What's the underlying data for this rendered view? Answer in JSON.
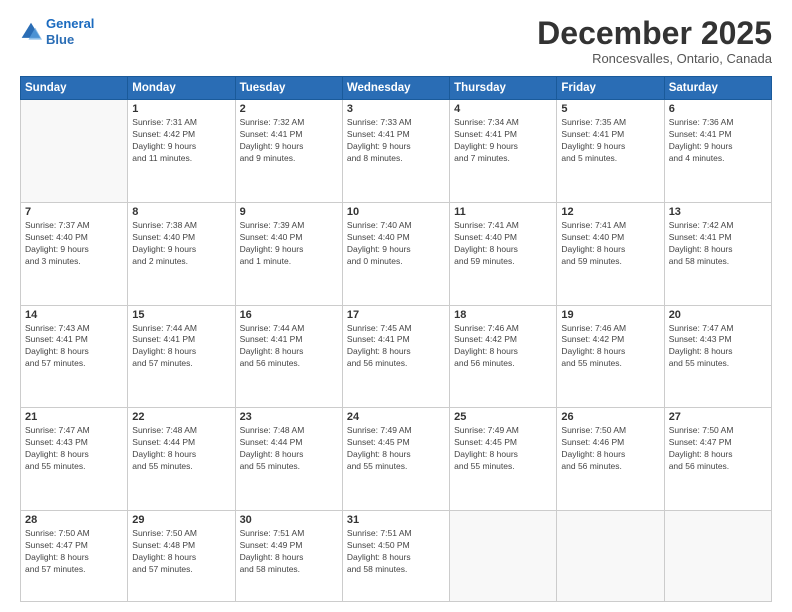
{
  "logo": {
    "line1": "General",
    "line2": "Blue"
  },
  "title": "December 2025",
  "location": "Roncesvalles, Ontario, Canada",
  "days_header": [
    "Sunday",
    "Monday",
    "Tuesday",
    "Wednesday",
    "Thursday",
    "Friday",
    "Saturday"
  ],
  "weeks": [
    [
      {
        "num": "",
        "info": ""
      },
      {
        "num": "1",
        "info": "Sunrise: 7:31 AM\nSunset: 4:42 PM\nDaylight: 9 hours\nand 11 minutes."
      },
      {
        "num": "2",
        "info": "Sunrise: 7:32 AM\nSunset: 4:41 PM\nDaylight: 9 hours\nand 9 minutes."
      },
      {
        "num": "3",
        "info": "Sunrise: 7:33 AM\nSunset: 4:41 PM\nDaylight: 9 hours\nand 8 minutes."
      },
      {
        "num": "4",
        "info": "Sunrise: 7:34 AM\nSunset: 4:41 PM\nDaylight: 9 hours\nand 7 minutes."
      },
      {
        "num": "5",
        "info": "Sunrise: 7:35 AM\nSunset: 4:41 PM\nDaylight: 9 hours\nand 5 minutes."
      },
      {
        "num": "6",
        "info": "Sunrise: 7:36 AM\nSunset: 4:41 PM\nDaylight: 9 hours\nand 4 minutes."
      }
    ],
    [
      {
        "num": "7",
        "info": "Sunrise: 7:37 AM\nSunset: 4:40 PM\nDaylight: 9 hours\nand 3 minutes."
      },
      {
        "num": "8",
        "info": "Sunrise: 7:38 AM\nSunset: 4:40 PM\nDaylight: 9 hours\nand 2 minutes."
      },
      {
        "num": "9",
        "info": "Sunrise: 7:39 AM\nSunset: 4:40 PM\nDaylight: 9 hours\nand 1 minute."
      },
      {
        "num": "10",
        "info": "Sunrise: 7:40 AM\nSunset: 4:40 PM\nDaylight: 9 hours\nand 0 minutes."
      },
      {
        "num": "11",
        "info": "Sunrise: 7:41 AM\nSunset: 4:40 PM\nDaylight: 8 hours\nand 59 minutes."
      },
      {
        "num": "12",
        "info": "Sunrise: 7:41 AM\nSunset: 4:40 PM\nDaylight: 8 hours\nand 59 minutes."
      },
      {
        "num": "13",
        "info": "Sunrise: 7:42 AM\nSunset: 4:41 PM\nDaylight: 8 hours\nand 58 minutes."
      }
    ],
    [
      {
        "num": "14",
        "info": "Sunrise: 7:43 AM\nSunset: 4:41 PM\nDaylight: 8 hours\nand 57 minutes."
      },
      {
        "num": "15",
        "info": "Sunrise: 7:44 AM\nSunset: 4:41 PM\nDaylight: 8 hours\nand 57 minutes."
      },
      {
        "num": "16",
        "info": "Sunrise: 7:44 AM\nSunset: 4:41 PM\nDaylight: 8 hours\nand 56 minutes."
      },
      {
        "num": "17",
        "info": "Sunrise: 7:45 AM\nSunset: 4:41 PM\nDaylight: 8 hours\nand 56 minutes."
      },
      {
        "num": "18",
        "info": "Sunrise: 7:46 AM\nSunset: 4:42 PM\nDaylight: 8 hours\nand 56 minutes."
      },
      {
        "num": "19",
        "info": "Sunrise: 7:46 AM\nSunset: 4:42 PM\nDaylight: 8 hours\nand 55 minutes."
      },
      {
        "num": "20",
        "info": "Sunrise: 7:47 AM\nSunset: 4:43 PM\nDaylight: 8 hours\nand 55 minutes."
      }
    ],
    [
      {
        "num": "21",
        "info": "Sunrise: 7:47 AM\nSunset: 4:43 PM\nDaylight: 8 hours\nand 55 minutes."
      },
      {
        "num": "22",
        "info": "Sunrise: 7:48 AM\nSunset: 4:44 PM\nDaylight: 8 hours\nand 55 minutes."
      },
      {
        "num": "23",
        "info": "Sunrise: 7:48 AM\nSunset: 4:44 PM\nDaylight: 8 hours\nand 55 minutes."
      },
      {
        "num": "24",
        "info": "Sunrise: 7:49 AM\nSunset: 4:45 PM\nDaylight: 8 hours\nand 55 minutes."
      },
      {
        "num": "25",
        "info": "Sunrise: 7:49 AM\nSunset: 4:45 PM\nDaylight: 8 hours\nand 55 minutes."
      },
      {
        "num": "26",
        "info": "Sunrise: 7:50 AM\nSunset: 4:46 PM\nDaylight: 8 hours\nand 56 minutes."
      },
      {
        "num": "27",
        "info": "Sunrise: 7:50 AM\nSunset: 4:47 PM\nDaylight: 8 hours\nand 56 minutes."
      }
    ],
    [
      {
        "num": "28",
        "info": "Sunrise: 7:50 AM\nSunset: 4:47 PM\nDaylight: 8 hours\nand 57 minutes."
      },
      {
        "num": "29",
        "info": "Sunrise: 7:50 AM\nSunset: 4:48 PM\nDaylight: 8 hours\nand 57 minutes."
      },
      {
        "num": "30",
        "info": "Sunrise: 7:51 AM\nSunset: 4:49 PM\nDaylight: 8 hours\nand 58 minutes."
      },
      {
        "num": "31",
        "info": "Sunrise: 7:51 AM\nSunset: 4:50 PM\nDaylight: 8 hours\nand 58 minutes."
      },
      {
        "num": "",
        "info": ""
      },
      {
        "num": "",
        "info": ""
      },
      {
        "num": "",
        "info": ""
      }
    ]
  ]
}
